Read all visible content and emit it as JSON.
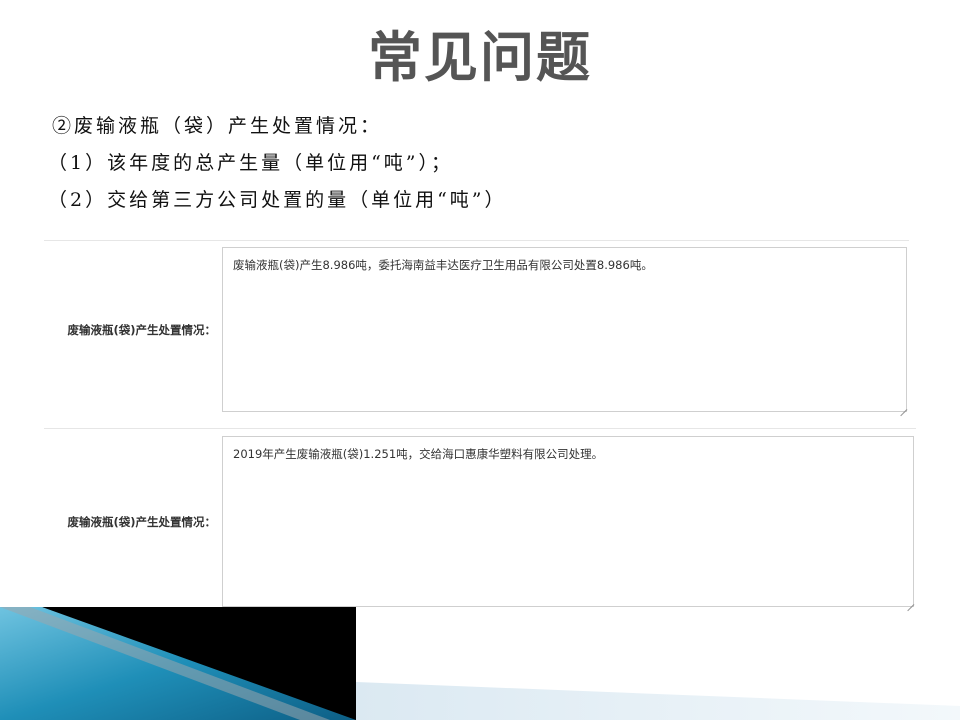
{
  "slide": {
    "title": "常见问题"
  },
  "intro": {
    "heading": "②废输液瓶（袋）产生处置情况：",
    "item1": "（1）该年度的总产生量（单位用“吨”）；",
    "item2": "（2）交给第三方公司处置的量（单位用“吨”）"
  },
  "form1": {
    "label": "废输液瓶(袋)产生处置情况：",
    "value": "废输液瓶(袋)产生8.986吨，委托海南益丰达医疗卫生用品有限公司处置8.986吨。"
  },
  "form2": {
    "label": "废输液瓶(袋)产生处置情况：",
    "value": "2019年产生废输液瓶(袋)1.251吨，交给海口惠康华塑料有限公司处理。"
  },
  "colors": {
    "title": "#555555",
    "deco_dark": "#000000",
    "deco_blue": "#1f8fb8",
    "deco_light": "#cfe3ef"
  }
}
